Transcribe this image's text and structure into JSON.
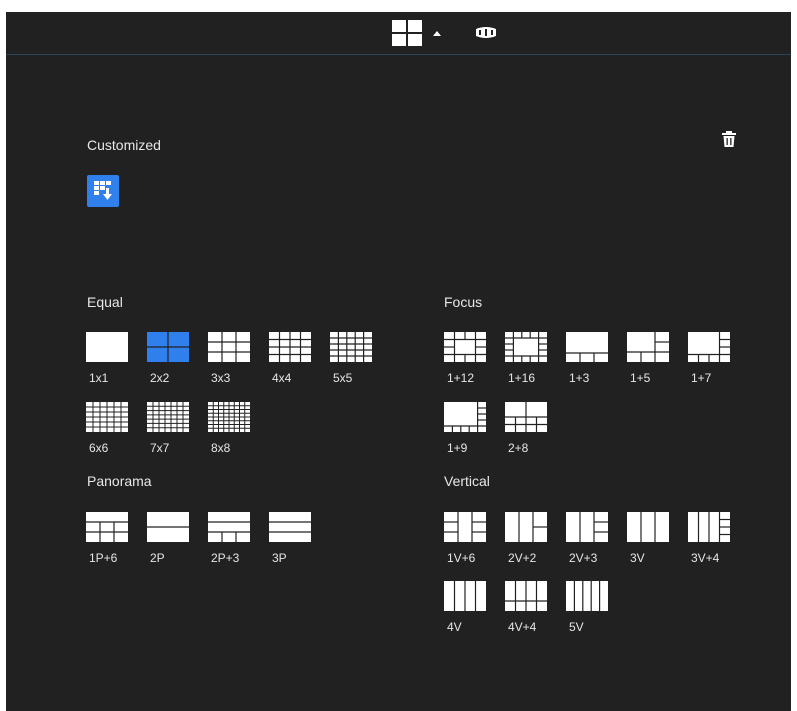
{
  "topbar": {
    "layout_icon": "grid-2x2-icon",
    "caret_icon": "caret-up-icon",
    "panorama_icon": "panorama-view-icon"
  },
  "customized": {
    "title": "Customized",
    "add_icon": "add-custom-layout-icon",
    "delete_icon": "trash-icon"
  },
  "equal": {
    "title": "Equal",
    "items": [
      {
        "label": "1x1",
        "selected": false
      },
      {
        "label": "2x2",
        "selected": true
      },
      {
        "label": "3x3",
        "selected": false
      },
      {
        "label": "4x4",
        "selected": false
      },
      {
        "label": "5x5",
        "selected": false
      },
      {
        "label": "6x6",
        "selected": false
      },
      {
        "label": "7x7",
        "selected": false
      },
      {
        "label": "8x8",
        "selected": false
      }
    ]
  },
  "focus": {
    "title": "Focus",
    "items": [
      {
        "label": "1+12"
      },
      {
        "label": "1+16"
      },
      {
        "label": "1+3"
      },
      {
        "label": "1+5"
      },
      {
        "label": "1+7"
      },
      {
        "label": "1+9"
      },
      {
        "label": "2+8"
      }
    ]
  },
  "panorama": {
    "title": "Panorama",
    "items": [
      {
        "label": "1P+6"
      },
      {
        "label": "2P"
      },
      {
        "label": "2P+3"
      },
      {
        "label": "3P"
      }
    ]
  },
  "vertical": {
    "title": "Vertical",
    "items": [
      {
        "label": "1V+6"
      },
      {
        "label": "2V+2"
      },
      {
        "label": "2V+3"
      },
      {
        "label": "3V"
      },
      {
        "label": "3V+4"
      },
      {
        "label": "4V"
      },
      {
        "label": "4V+4"
      },
      {
        "label": "5V"
      }
    ]
  },
  "colors": {
    "background": "#212121",
    "accent": "#2f80ed",
    "tile": "#ffffff"
  }
}
